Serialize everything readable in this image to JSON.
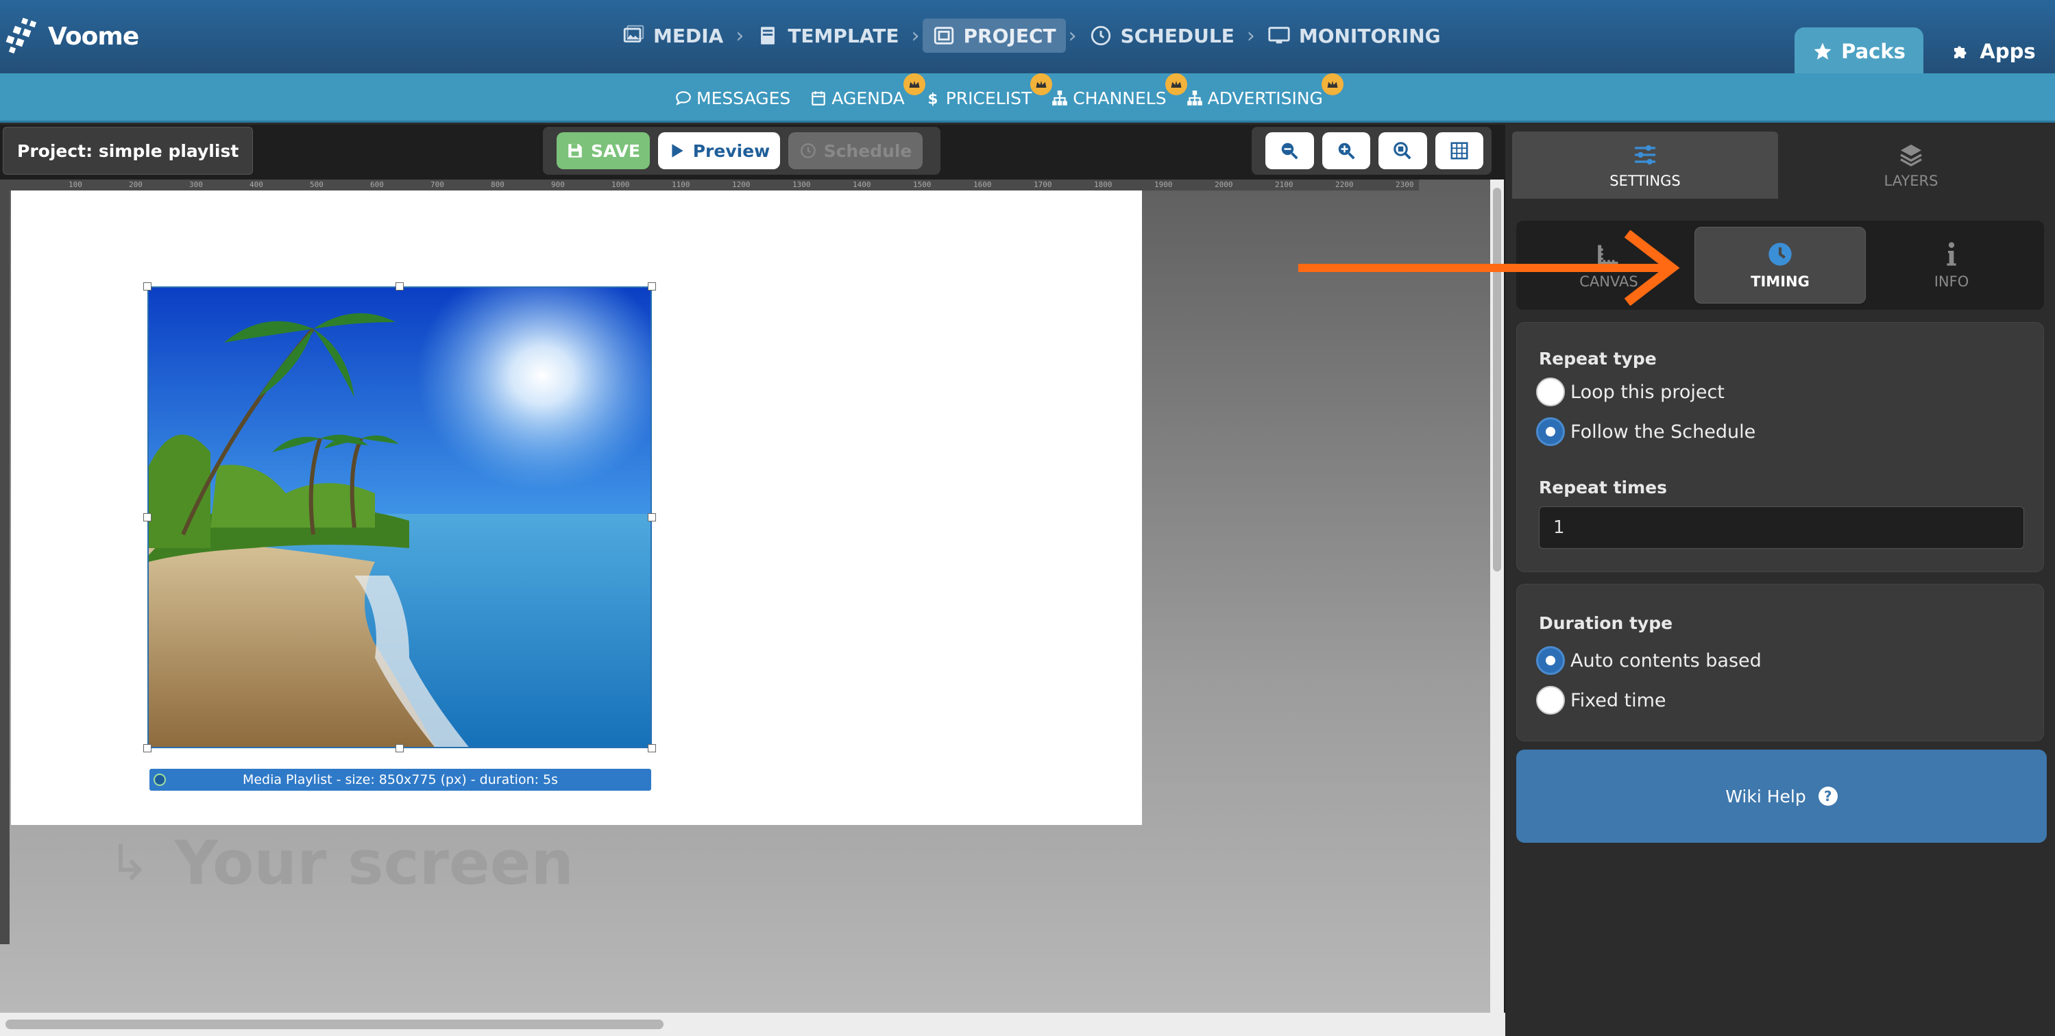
{
  "app": {
    "logo_text": "Voome"
  },
  "main_nav": [
    {
      "label": "MEDIA",
      "icon": "image-icon"
    },
    {
      "label": "TEMPLATE",
      "icon": "template-icon"
    },
    {
      "label": "PROJECT",
      "icon": "project-icon",
      "active": true
    },
    {
      "label": "SCHEDULE",
      "icon": "clock-icon"
    },
    {
      "label": "MONITORING",
      "icon": "monitor-icon"
    }
  ],
  "corner_tabs": {
    "packs": "Packs",
    "apps": "Apps"
  },
  "sub_nav": [
    {
      "label": "MESSAGES",
      "icon": "chat-icon",
      "premium": false
    },
    {
      "label": "AGENDA",
      "icon": "calendar-icon",
      "premium": true
    },
    {
      "label": "PRICELIST",
      "icon": "dollar-icon",
      "premium": true
    },
    {
      "label": "CHANNELS",
      "icon": "sitemap-icon",
      "premium": true
    },
    {
      "label": "ADVERTISING",
      "icon": "sitemap-icon",
      "premium": true
    }
  ],
  "toolbar": {
    "project_label": "Project: simple playlist",
    "save": "SAVE",
    "preview": "Preview",
    "schedule": "Schedule",
    "zoom_icons": [
      "zoom-out-icon",
      "zoom-in-icon",
      "zoom-fit-icon",
      "grid-icon"
    ]
  },
  "ruler_labels": [
    "100",
    "200",
    "300",
    "400",
    "500",
    "600",
    "700",
    "800",
    "900",
    "1000",
    "1100",
    "1200",
    "1300",
    "1400",
    "1500",
    "1600",
    "1700",
    "1800",
    "1900",
    "2000",
    "2100",
    "2200",
    "2300"
  ],
  "canvas": {
    "media_caption": "Media Playlist - size: 850x775 (px) - duration: 5s",
    "screen_label": "Your screen"
  },
  "panel": {
    "tabs": [
      {
        "label": "SETTINGS",
        "icon": "sliders-icon",
        "active": true
      },
      {
        "label": "LAYERS",
        "icon": "layers-icon",
        "active": false
      }
    ],
    "subtabs": [
      {
        "label": "CANVAS",
        "icon": "ruler-icon",
        "active": false
      },
      {
        "label": "TIMING",
        "icon": "clock-icon",
        "active": true
      },
      {
        "label": "INFO",
        "icon": "info-icon",
        "active": false
      }
    ],
    "repeat": {
      "title": "Repeat type",
      "options": [
        {
          "label": "Loop this project",
          "checked": false
        },
        {
          "label": "Follow the Schedule",
          "checked": true
        }
      ],
      "times_label": "Repeat times",
      "times_value": "1"
    },
    "duration": {
      "title": "Duration type",
      "options": [
        {
          "label": "Auto contents based",
          "checked": true
        },
        {
          "label": "Fixed time",
          "checked": false
        }
      ]
    },
    "wiki_help": "Wiki Help",
    "wiki_help_icon": "?"
  },
  "colors": {
    "accent_orange": "#ff6a13",
    "brand_blue": "#2f7ac8"
  }
}
